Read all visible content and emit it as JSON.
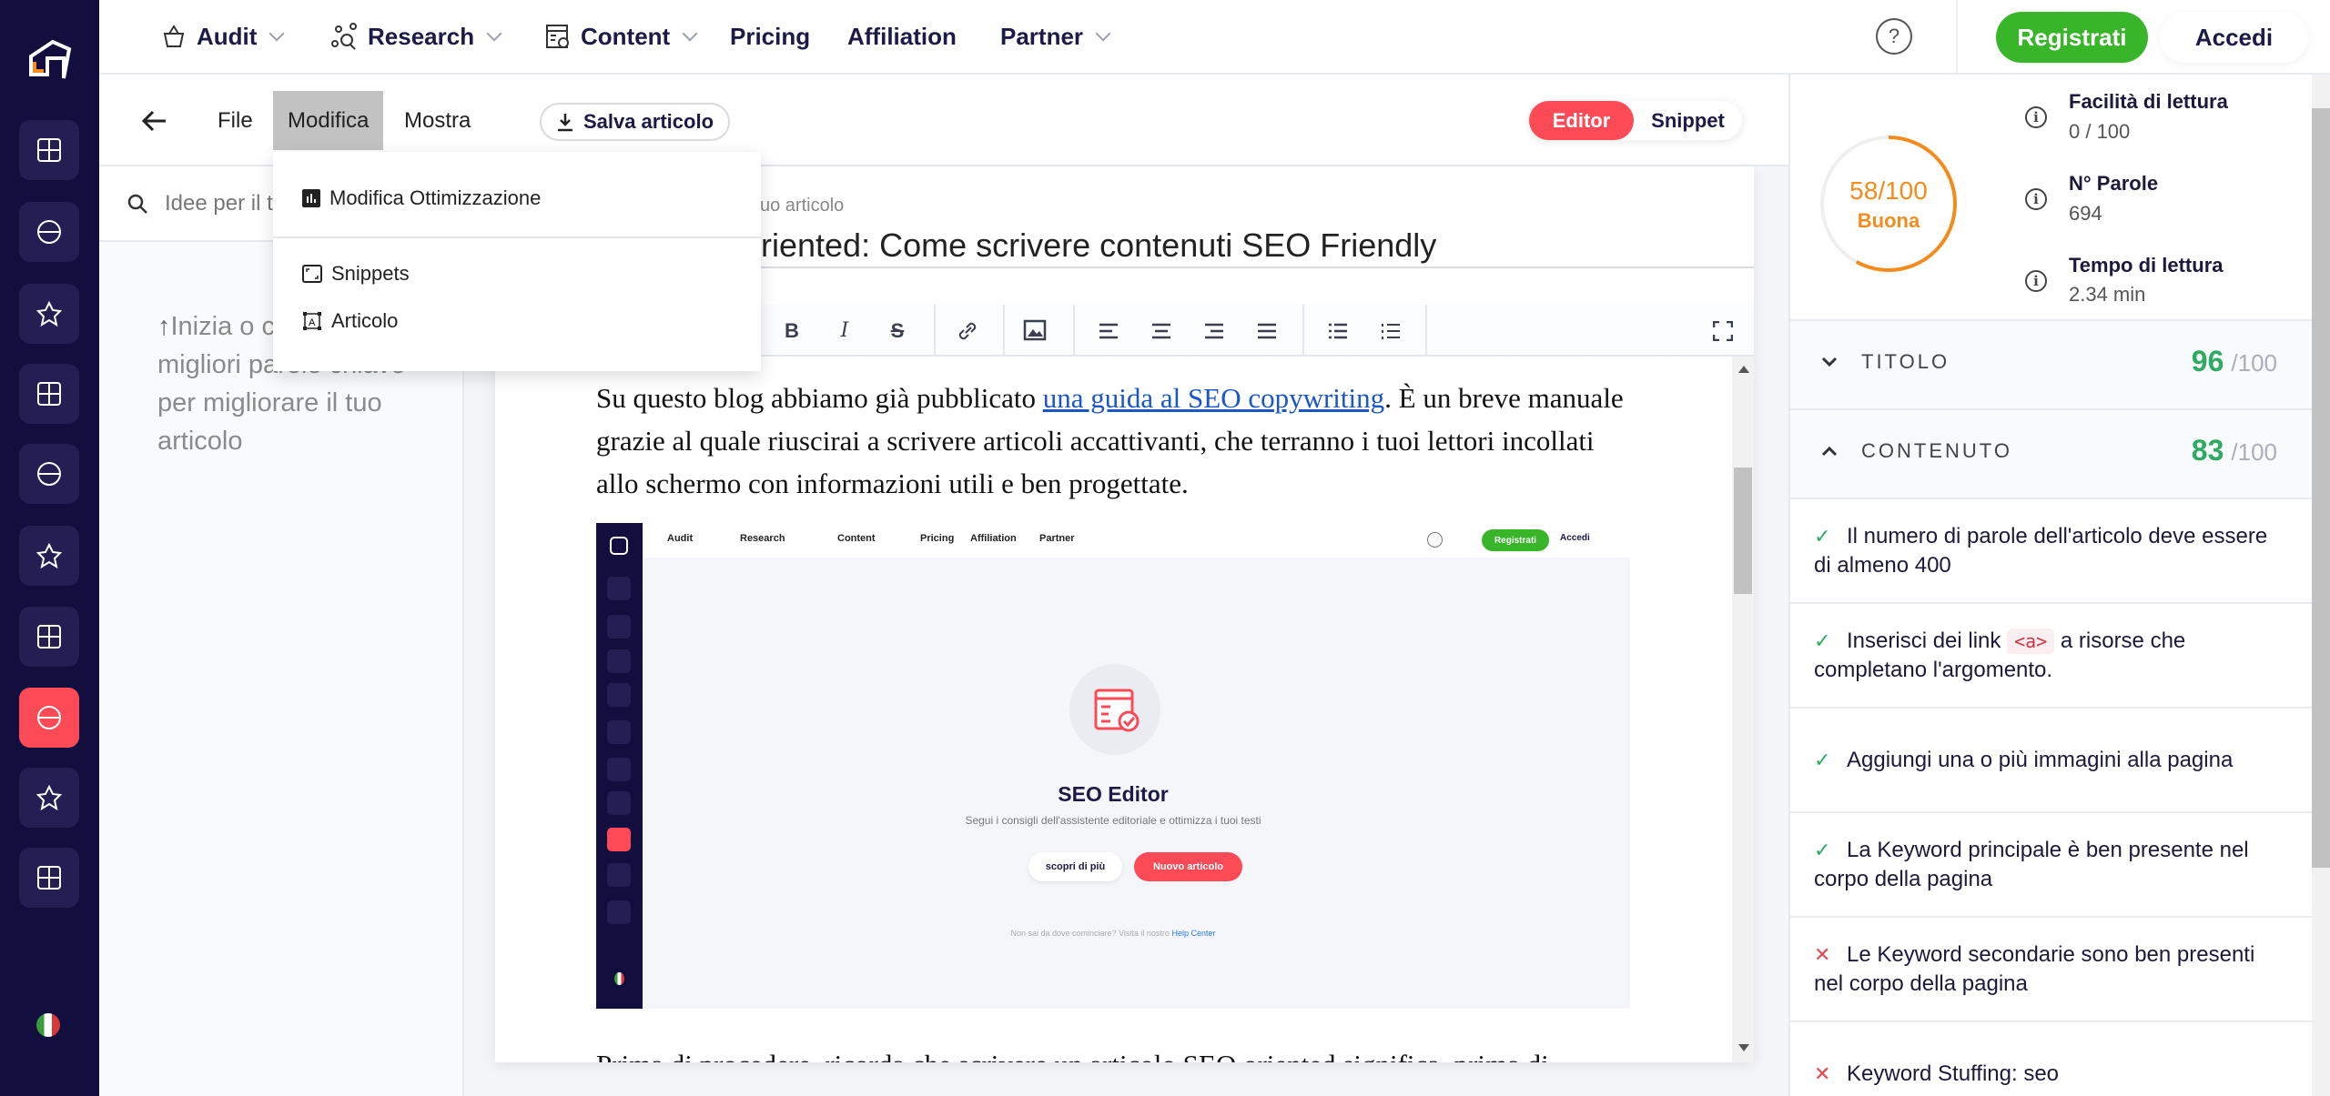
{
  "sidebar": {
    "items": [
      "dashboard-icon",
      "audit-icon",
      "table-icon",
      "globe-icon",
      "compare-icon",
      "graph-icon",
      "star-icon",
      "seo-editor-icon",
      "target-icon",
      "profile-icon"
    ],
    "active": "seo-editor-icon",
    "flag": "italy-flag"
  },
  "topnav": {
    "items": [
      {
        "label": "Audit",
        "icon": "audit-icon",
        "dropdown": true
      },
      {
        "label": "Research",
        "icon": "research-icon",
        "dropdown": true
      },
      {
        "label": "Content",
        "icon": "content-icon",
        "dropdown": true
      },
      {
        "label": "Pricing"
      },
      {
        "label": "Affiliation"
      },
      {
        "label": "Partner",
        "dropdown": true
      }
    ],
    "help": "?",
    "register": "Registrati",
    "login": "Accedi"
  },
  "toolbar": {
    "file": "File",
    "edit": "Modifica",
    "view": "Mostra",
    "save": "Salva articolo",
    "editor": "Editor",
    "snippet": "Snippet"
  },
  "menu": {
    "items": [
      {
        "label": "Modifica Ottimizzazione",
        "icon": "chart-icon"
      },
      {
        "label": "Snippets",
        "icon": "snippet-icon"
      },
      {
        "label": "Articolo",
        "icon": "article-icon"
      }
    ]
  },
  "ideas": {
    "placeholder": "Idee per il tu",
    "hint": "Inizia o cercando le migliori parole chiave per migliorare il tuo articolo"
  },
  "article": {
    "title_label": "uo articolo",
    "title": "riented: Come scrivere contenuti SEO Friendly",
    "p1_before": "Su questo blog abbiamo già pubblicato ",
    "p1_link": "una guida al SEO copywriting",
    "p1_after": ". È un breve manuale grazie al quale riuscirai a scrivere articoli accattivanti, che terranno i tuoi lettori incollati allo schermo con informazioni utili e ben progettate.",
    "p2": "Prima di procedere, ricorda che scrivere un articolo SEO oriented significa, prima di"
  },
  "embedded": {
    "nav": [
      "Audit",
      "Research",
      "Content",
      "Pricing",
      "Affiliation",
      "Partner"
    ],
    "register": "Registrati",
    "login": "Accedi",
    "title": "SEO Editor",
    "subtitle": "Segui i consigli dell'assistente editoriale e ottimizza i tuoi testi",
    "more": "scopri di più",
    "new": "Nuovo articolo",
    "footer": "Non sai da dove cominciare? Visita il nostro",
    "footer_link": "Help Center"
  },
  "score": {
    "value": 58,
    "max": 100,
    "text": "58/100",
    "label": "Buona",
    "color": "#f28c1e"
  },
  "stats": [
    {
      "label": "Facilità di lettura",
      "value": "0 / 100"
    },
    {
      "label": "N° Parole",
      "value": "694"
    },
    {
      "label": "Tempo di lettura",
      "value": "2.34 min"
    }
  ],
  "sections": [
    {
      "label": "TITOLO",
      "score": "96",
      "max": "/100",
      "expanded": false
    },
    {
      "label": "CONTENUTO",
      "score": "83",
      "max": "/100",
      "expanded": true
    }
  ],
  "checks": [
    {
      "ok": true,
      "text": "Il numero di parole dell'articolo deve essere di almeno 400"
    },
    {
      "ok": true,
      "before": "Inserisci dei link",
      "tag": "<a>",
      "after": "a risorse che completano l'argomento."
    },
    {
      "ok": true,
      "text": "Aggiungi una o più immagini alla pagina"
    },
    {
      "ok": true,
      "text": "La Keyword principale è ben presente nel corpo della pagina"
    },
    {
      "ok": false,
      "text": "Le Keyword secondarie sono ben presenti nel corpo della pagina"
    },
    {
      "ok": false,
      "text": "Keyword Stuffing: seo"
    }
  ],
  "colors": {
    "sidebar": "#120e3e",
    "accent": "#fc4b57",
    "green": "#39b52a",
    "score_green": "#2eaa62",
    "fail": "#e5484d"
  }
}
